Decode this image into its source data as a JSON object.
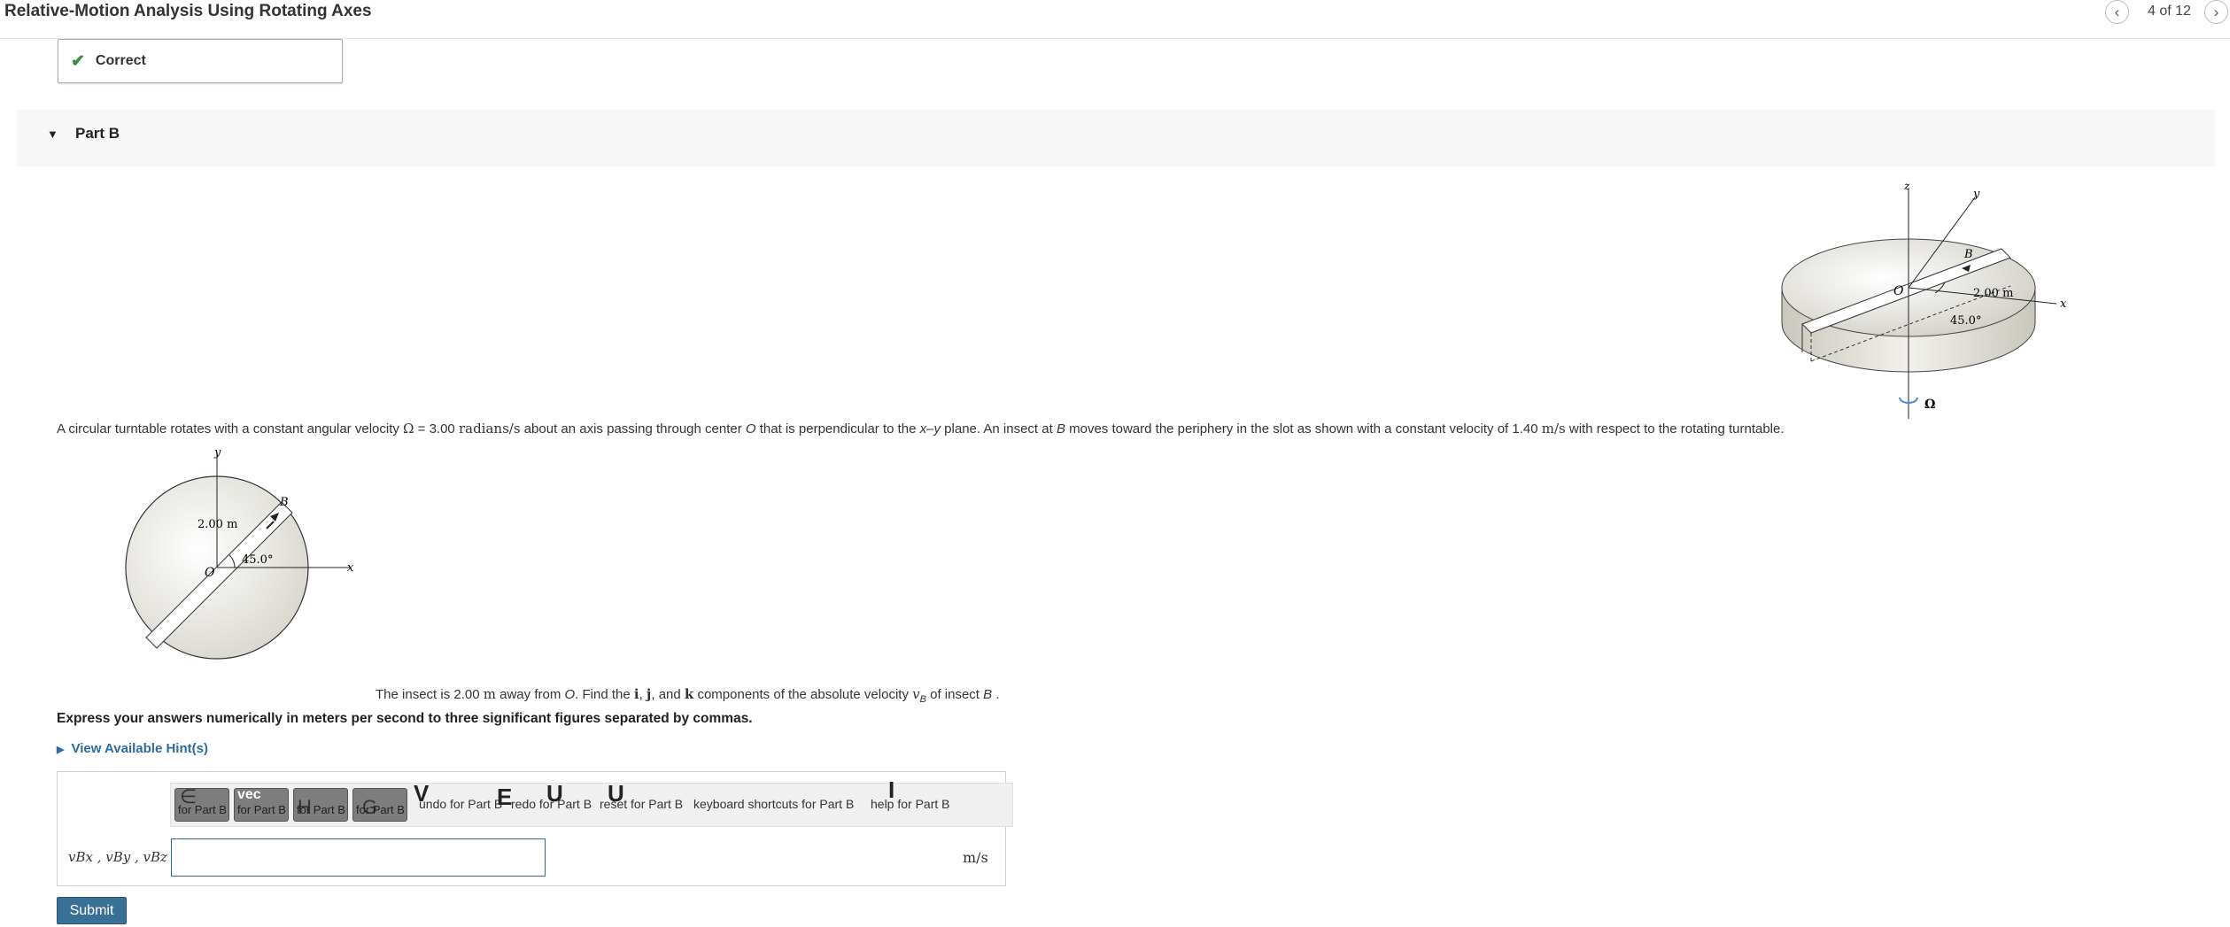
{
  "header": {
    "title": "Relative-Motion Analysis Using Rotating Axes",
    "page_count": "4 of 12",
    "prev_icon": "chevron-left-icon",
    "next_icon": "chevron-right-icon"
  },
  "feedback": {
    "status": "Correct",
    "icon": "check-icon",
    "color": "#3d8c40"
  },
  "part": {
    "label": "Part B"
  },
  "problem": {
    "t1": "A circular turntable rotates with a constant angular velocity ",
    "omega": "Ω",
    "t2": " = 3.00 ",
    "unit1": "radians/s",
    "t3": " about an axis passing through center ",
    "O": "O",
    "t4": " that is perpendicular to the ",
    "xy": "x",
    "dash": "–",
    "y": "y",
    "t5": " plane. An insect at ",
    "B": "B",
    "t6": " moves toward the periphery in the slot as shown with a constant velocity of 1.40 ",
    "unit2": "m/s",
    "t7": " with respect to the rotating turntable."
  },
  "question": {
    "t1": "The insect is 2.00 ",
    "m": "m",
    "t2": " away from ",
    "O": "O",
    "t3": ". Find the ",
    "i": "i",
    "comma1": ", ",
    "j": "j",
    "t4": ", and ",
    "k": "k",
    "t5": " components of the absolute velocity ",
    "v": "v",
    "vsub": "B",
    "t6": " of insect ",
    "B": "B",
    "t7": " ."
  },
  "instruction": "Express your answers numerically in meters per second to three significant figures separated by commas.",
  "hints": {
    "label": "View Available Hint(s)"
  },
  "toolbar": {
    "tool1_label": "for Part B",
    "tool2_label": "for Part B",
    "tool2_glyph": "vec",
    "tool3_label": "for Part B",
    "tool4_label": "for Part B",
    "undo": "undo for Part B",
    "redo": "redo for Part B",
    "reset": "reset for Part B",
    "keyboard": "keyboard shortcuts for Part B",
    "help": "help for Part B"
  },
  "answer": {
    "label": "vBx , vBy , vBz =",
    "value": "",
    "units": "m/s"
  },
  "submit": {
    "label": "Submit"
  },
  "figure_3d": {
    "z": "z",
    "y": "y",
    "x": "x",
    "O": "O",
    "B": "B",
    "dist": "2.00 m",
    "angle": "45.0°",
    "omega": "Ω"
  },
  "figure_2d": {
    "y": "y",
    "x": "x",
    "O": "O",
    "B": "B",
    "dist": "2.00 m",
    "angle": "45.0°"
  }
}
